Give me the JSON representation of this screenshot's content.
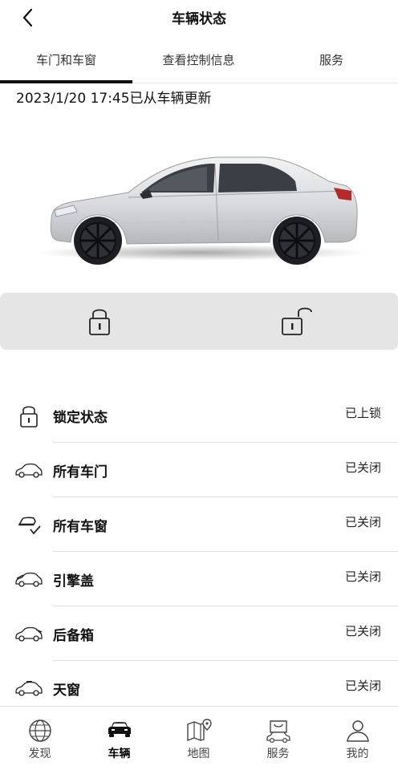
{
  "header": {
    "title": "车辆状态",
    "back_icon": "chevron-left-icon"
  },
  "tabs": [
    {
      "label": "车门和车窗",
      "active": true
    },
    {
      "label": "查看控制信息",
      "active": false
    },
    {
      "label": "服务",
      "active": false
    }
  ],
  "updated_text": "2023/1/20 17:45已从车辆更新",
  "lock_controls": {
    "lock_icon": "lock-closed-icon",
    "unlock_icon": "lock-open-icon"
  },
  "status_items": [
    {
      "label": "锁定状态",
      "value": "已上锁",
      "icon": "lock-closed-icon"
    },
    {
      "label": "所有车门",
      "value": "已关闭",
      "icon": "car-doors-icon"
    },
    {
      "label": "所有车窗",
      "value": "已关闭",
      "icon": "car-window-check-icon"
    },
    {
      "label": "引擎盖",
      "value": "已关闭",
      "icon": "car-hood-icon"
    },
    {
      "label": "后备箱",
      "value": "已关闭",
      "icon": "car-trunk-icon"
    },
    {
      "label": "天窗",
      "value": "已关闭",
      "icon": "car-sunroof-icon"
    }
  ],
  "bottom_nav": [
    {
      "label": "发现",
      "icon": "globe-icon",
      "active": false
    },
    {
      "label": "车辆",
      "icon": "car-icon",
      "active": true
    },
    {
      "label": "地图",
      "icon": "map-pin-icon",
      "active": false
    },
    {
      "label": "服务",
      "icon": "service-bag-icon",
      "active": false
    },
    {
      "label": "我的",
      "icon": "user-icon",
      "active": false
    }
  ],
  "colors": {
    "text": "#111111",
    "lock_bar_bg": "#e5e5e5",
    "car_body": "#dcdde0",
    "divider": "#dedede"
  }
}
